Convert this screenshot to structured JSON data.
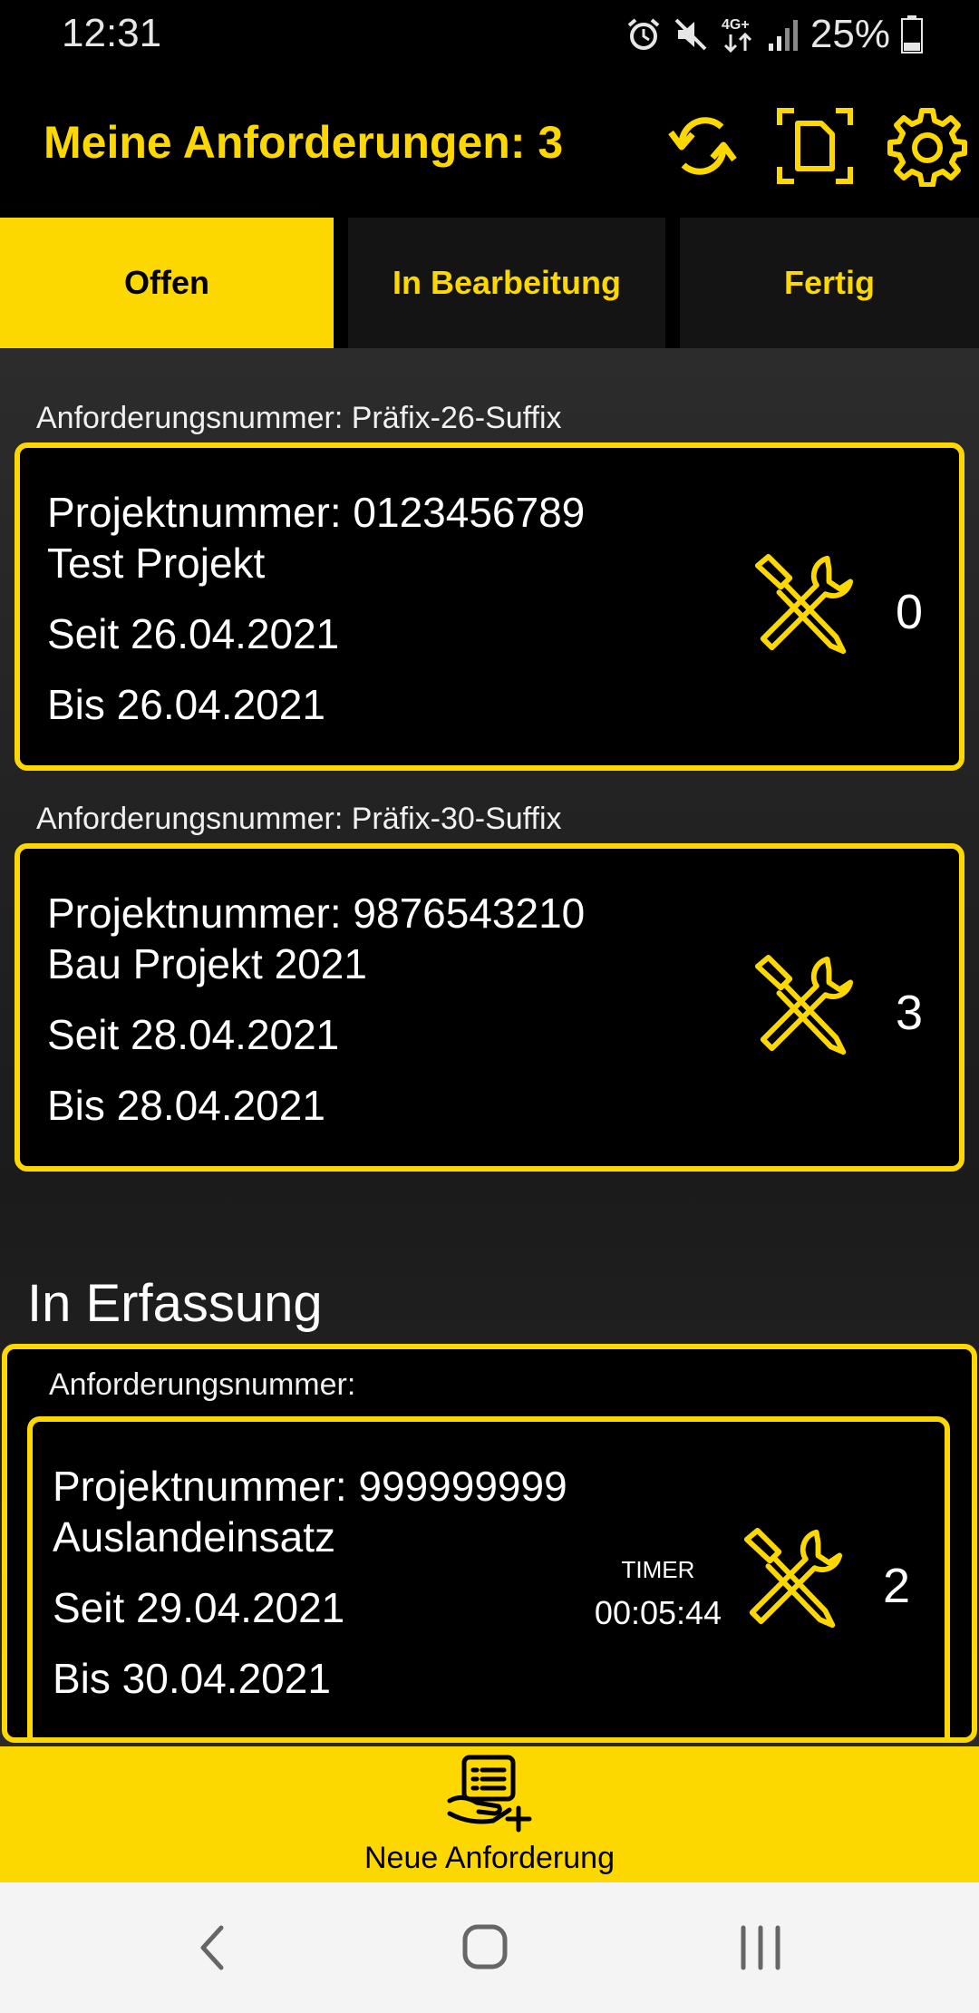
{
  "status_bar": {
    "time": "12:31",
    "icons": [
      "alarm-icon",
      "mute-icon",
      "network-4g-icon",
      "signal-icon",
      "battery-icon"
    ],
    "network_label": "4G+",
    "battery": "25%"
  },
  "app_bar": {
    "title": "Meine Anforderungen: 3",
    "icons": [
      "refresh-icon",
      "document-scan-icon",
      "gear-icon"
    ]
  },
  "tabs": [
    {
      "label": "Offen",
      "active": true
    },
    {
      "label": "In Bearbeitung",
      "active": false
    },
    {
      "label": "Fertig",
      "active": false
    }
  ],
  "requests": [
    {
      "number_label": "Anforderungsnummer: Präfix-26-Suffix",
      "project_number": "Projektnummer: 0123456789",
      "project_name": "Test Projekt",
      "since": "Seit 26.04.2021",
      "until": "Bis 26.04.2021",
      "count": "0"
    },
    {
      "number_label": "Anforderungsnummer: Präfix-30-Suffix",
      "project_number": "Projektnummer: 9876543210",
      "project_name": "Bau Projekt 2021",
      "since": "Seit 28.04.2021",
      "until": "Bis 28.04.2021",
      "count": "3"
    }
  ],
  "in_progress_section": {
    "title": "In Erfassung",
    "number_label": "Anforderungsnummer:",
    "project_number": "Projektnummer: 999999999",
    "project_name": "Auslandeinsatz",
    "since": "Seit 29.04.2021",
    "until": "Bis 30.04.2021",
    "timer_label": "TIMER",
    "timer_value": "00:05:44",
    "count": "2"
  },
  "bottom_action": {
    "label": "Neue Anforderung",
    "icon": "new-request-icon"
  },
  "colors": {
    "accent": "#fcd800",
    "background": "#000000",
    "text": "#ffffff"
  }
}
